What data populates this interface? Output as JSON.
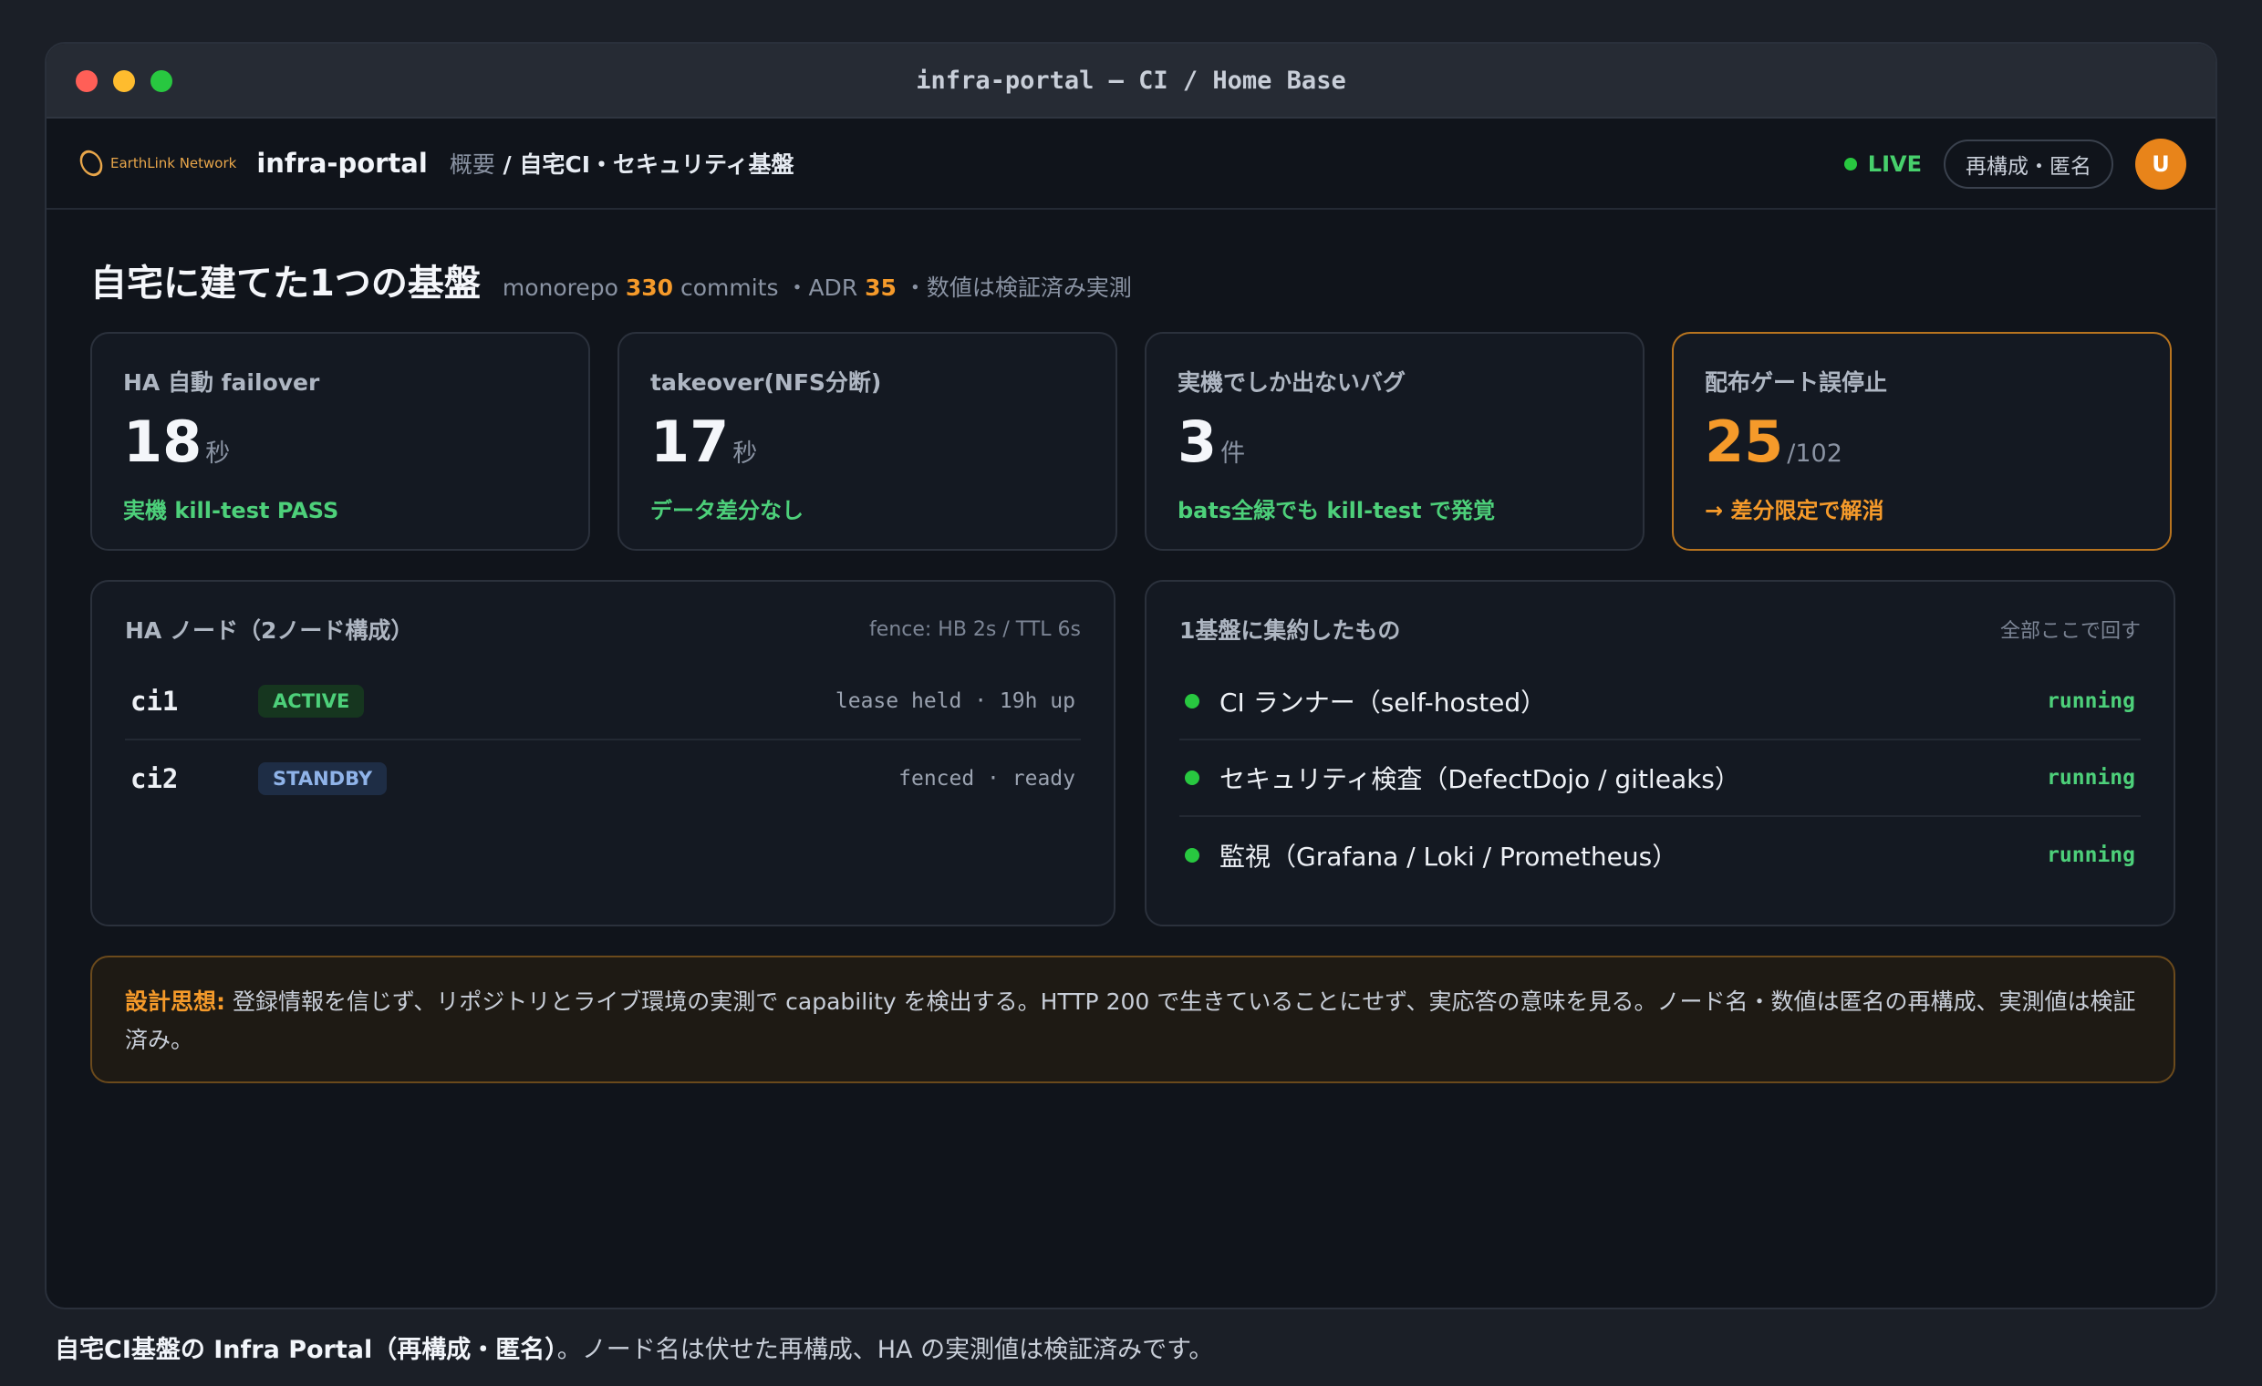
{
  "window": {
    "title": "infra-portal — CI / Home Base"
  },
  "nav": {
    "logo_text": "EarthLink Network",
    "app_name": "infra-portal",
    "breadcrumb_parent": "概要",
    "breadcrumb_sep": " / ",
    "breadcrumb_current": "自宅CI・セキュリティ基盤",
    "live_label": "LIVE",
    "mode_pill": "再構成・匿名",
    "avatar_initial": "U"
  },
  "header": {
    "title": "自宅に建てた1つの基盤",
    "sub_prefix": "monorepo ",
    "commits_count": "330",
    "sub_commits": " commits ・ADR ",
    "adr_count": "35",
    "sub_suffix": " ・数値は検証済み実測"
  },
  "cards": [
    {
      "label": "HA 自動 failover",
      "value": "18",
      "unit": "秒",
      "note": "実機 kill-test PASS"
    },
    {
      "label": "takeover(NFS分断)",
      "value": "17",
      "unit": "秒",
      "note": "データ差分なし"
    },
    {
      "label": "実機でしか出ないバグ",
      "value": "3",
      "unit": "件",
      "note": "bats全緑でも kill-test で発覚"
    },
    {
      "label": "配布ゲート誤停止",
      "value": "25",
      "unit": "/102",
      "note": "→ 差分限定で解消"
    }
  ],
  "ha_panel": {
    "title": "HA ノード（2ノード構成）",
    "meta": "fence: HB 2s / TTL 6s",
    "nodes": [
      {
        "name": "ci1",
        "badge": "ACTIVE",
        "info": "lease held · 19h up"
      },
      {
        "name": "ci2",
        "badge": "STANDBY",
        "info": "fenced · ready"
      }
    ]
  },
  "services_panel": {
    "title": "1基盤に集約したもの",
    "meta": "全部ここで回す",
    "services": [
      {
        "name": "CI ランナー（self-hosted）",
        "status": "running"
      },
      {
        "name": "セキュリティ検査（DefectDojo / gitleaks）",
        "status": "running"
      },
      {
        "name": "監視（Grafana / Loki / Prometheus）",
        "status": "running"
      }
    ]
  },
  "philosophy": {
    "label": "設計思想:",
    "text": " 登録情報を信じず、リポジトリとライブ環境の実測で capability を検出する。HTTP 200 で生きていることにせず、実応答の意味を見る。ノード名・数値は匿名の再構成、実測値は検証済み。"
  },
  "caption": {
    "bold": "自宅CI基盤の Infra Portal（再構成・匿名）",
    "rest": "。ノード名は伏せた再構成、HA の実測値は検証済みです。"
  },
  "colors": {
    "accent_orange": "#f59a2a",
    "status_green": "#4dd07a",
    "bg": "#10141b"
  }
}
